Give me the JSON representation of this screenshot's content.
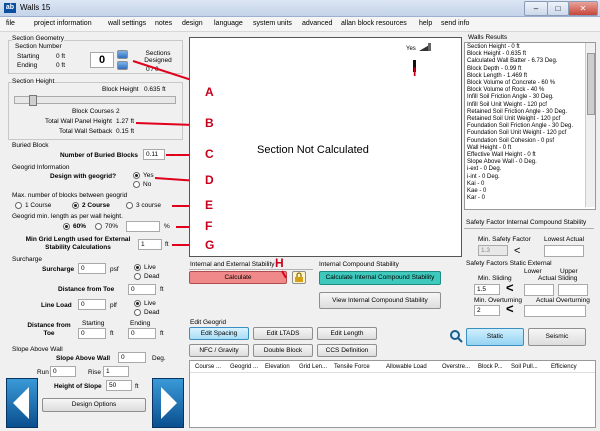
{
  "window": {
    "title": "Walls 15",
    "app_icon": "ab",
    "min": "–",
    "max": "□",
    "close": "✕"
  },
  "menu": [
    "file",
    "project information",
    "wall settings",
    "notes",
    "design",
    "language",
    "system units",
    "advanced",
    "allan block resources",
    "help",
    "send info"
  ],
  "section_geometry": {
    "title": "Section Geometry",
    "section_number_label": "Section Number",
    "starting_label": "Starting",
    "starting_value": "0 ft",
    "ending_label": "Ending",
    "ending_value": "0 ft",
    "section_number": "0",
    "sections_designed_label": "Sections Designed",
    "sections_designed": "0 / 0"
  },
  "section_height": {
    "title": "Section Height",
    "block_height_label": "Block Height",
    "block_height": "0.635 ft",
    "block_courses_label": "Block Courses",
    "block_courses": "2",
    "total_panel_label": "Total Wall Panel Height",
    "total_panel": "1.27 ft",
    "total_setback_label": "Total Wall Setback",
    "total_setback": "0.15 ft"
  },
  "buried_block": {
    "title": "Buried Block",
    "label": "Number of Buried Blocks",
    "value": "0.11"
  },
  "geogrid_info": {
    "title": "Geogrid Information",
    "design_label": "Design with geogrid?",
    "yes": "Yes",
    "no": "No"
  },
  "max_blocks": {
    "title": "Max. number of blocks between geogrid",
    "opt1": "1 Course",
    "opt2": "2 Course",
    "opt3": "3 course"
  },
  "grid_min": {
    "title": "Geogrid min. length as per wall height.",
    "opt60": "60%",
    "opt70": "70%",
    "percent": "%",
    "custom_value": ""
  },
  "min_grid": {
    "label": "Min Grid Length used for External Stability Calculations",
    "value": "1",
    "unit": "ft"
  },
  "surcharge": {
    "title": "Surcharge",
    "surcharge_label": "Surcharge",
    "surcharge_value": "0",
    "psf": "psf",
    "live": "Live",
    "dead": "Dead",
    "dist_toe_label": "Distance from Toe",
    "dist_toe_value": "0",
    "ft": "ft",
    "line_load_label": "Line Load",
    "line_load_value": "0",
    "plf": "plf",
    "dist_from_label": "Distance from Toe",
    "starting_label": "Starting",
    "ending_label": "Ending",
    "start_value": "0",
    "end_value": "0"
  },
  "slope": {
    "title": "Slope Above Wall",
    "slope_label": "Slope Above Wall",
    "slope_value": "0",
    "deg": "Deg.",
    "run_label": "Run",
    "run_value": "0",
    "rise_label": "Rise",
    "rise_value": "1",
    "height_label": "Height of Slope",
    "height_value": "50",
    "ft": "ft",
    "design_options": "Design Options"
  },
  "canvas": {
    "message": "Section Not Calculated",
    "yes_label": "Yes"
  },
  "stability": {
    "ie_title": "Internal and External Stability",
    "calculate": "Calculate",
    "ics_title": "Internal Compound Stability",
    "calc_ics": "Calculate Internal Compound Stability",
    "view_ics": "View Internal Compound Stability"
  },
  "edit_geogrid": {
    "title": "Edit Geogrid",
    "buttons": [
      "Edit Spacing",
      "Edit LTADS",
      "Edit Length",
      "NFC / Gravity",
      "Double Block",
      "CCS Definition"
    ]
  },
  "grid_columns": [
    "Course ...",
    "Geogrid ...",
    "Elevation",
    "Grid Len...",
    "Tensile Force",
    "Allowable Load",
    "Overstre...",
    "Block P...",
    "Soil Pull...",
    "Efficiency"
  ],
  "results": {
    "title": "Walls Results",
    "lines": [
      "Section Height - 0 ft",
      "Block Height - 0.635 ft",
      "Calculated Wall Batter - 6.73 Deg.",
      "Block Depth - 0.99 ft",
      "Block Length - 1.469 ft",
      "Block Volume of Concrete - 60 %",
      "Block Volume of Rock - 40 %",
      "Infill Soil Friction Angle - 30 Deg.",
      "Infill Soil Unit Weight - 120 pcf",
      "Retained Soil Friction Angle - 30 Deg.",
      "Retained Soil Unit Weight - 120 pcf",
      "Foundation Soil Friction Angle - 30 Deg.",
      "Foundation Soil Unit Weight - 120 pcf",
      "Foundation Soil Cohesion - 0 psf",
      "Wall Height - 0 ft",
      "Effective Wall Height - 0 ft",
      "Slope Above Wall - 0 Deg.",
      "i-ext - 0 Deg.",
      "i-int - 0 Deg.",
      "Kai - 0",
      "Kae - 0",
      "Kar - 0"
    ]
  },
  "safety_ics": {
    "title": "Safety Factor Internal Compound Stability",
    "min_label": "Min. Safety Factor",
    "min_value": "1.3",
    "lowest_label": "Lowest Actual",
    "lt": "<"
  },
  "safety_static": {
    "title": "Safety Factors Static External",
    "min_sliding_label": "Min. Sliding",
    "min_sliding": "1.5",
    "lower_label": "Lower",
    "upper_label": "Upper",
    "actual_sliding_label": "Actual Sliding",
    "min_overturning_label": "Min. Overturning",
    "min_overturning": "2",
    "actual_overturning_label": "Actual Overturning",
    "lt": "<"
  },
  "modes": {
    "static": "Static",
    "seismic": "Seismic"
  },
  "markers": [
    "A",
    "B",
    "C",
    "D",
    "E",
    "F",
    "G",
    "H",
    "I"
  ],
  "colors": {
    "calculate_bg": "#f08a8a",
    "calc_ics_bg": "#3fc9bd",
    "annotation": "#e0001b"
  }
}
